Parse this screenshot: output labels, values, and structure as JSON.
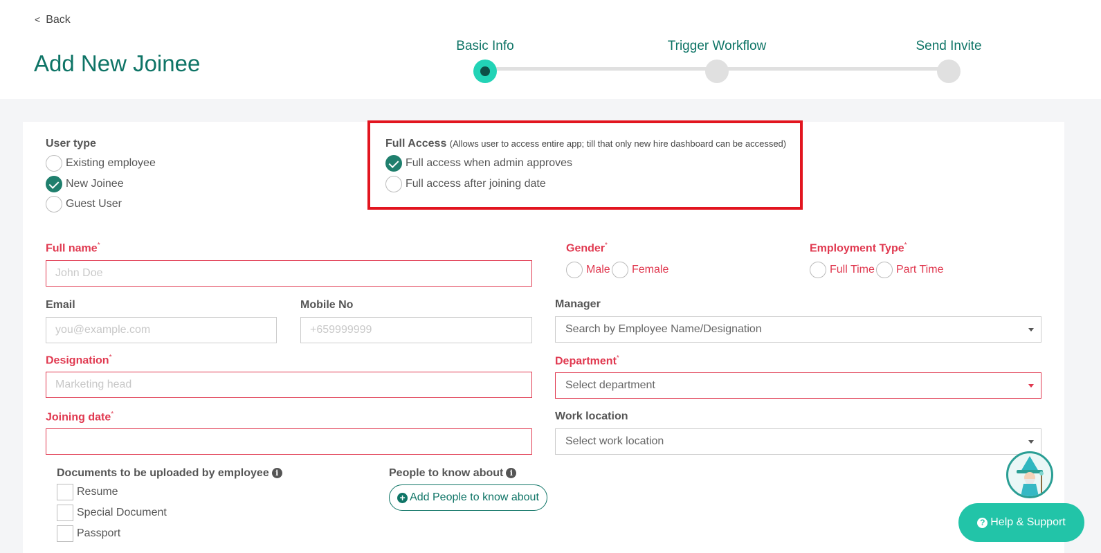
{
  "header": {
    "back_label": "Back",
    "page_title": "Add New Joinee"
  },
  "stepper": {
    "steps": [
      {
        "label": "Basic Info",
        "active": true
      },
      {
        "label": "Trigger Workflow",
        "active": false
      },
      {
        "label": "Send Invite",
        "active": false
      }
    ]
  },
  "user_type": {
    "label": "User type",
    "options": [
      {
        "label": "Existing employee",
        "checked": false
      },
      {
        "label": "New Joinee",
        "checked": true
      },
      {
        "label": "Guest User",
        "checked": false
      }
    ]
  },
  "full_access": {
    "label": "Full Access",
    "hint": "(Allows user to access entire app; till that only new hire dashboard can be accessed)",
    "options": [
      {
        "label": "Full access when admin approves",
        "checked": true
      },
      {
        "label": "Full access after joining date",
        "checked": false
      }
    ]
  },
  "form": {
    "full_name": {
      "label": "Full name",
      "required_mark": "*",
      "placeholder": "John Doe",
      "value": ""
    },
    "gender": {
      "label": "Gender",
      "required_mark": "*",
      "options": [
        "Male",
        "Female"
      ]
    },
    "employment_type": {
      "label": "Employment Type",
      "required_mark": "*",
      "options": [
        "Full Time",
        "Part Time"
      ]
    },
    "email": {
      "label": "Email",
      "placeholder": "you@example.com",
      "value": ""
    },
    "mobile": {
      "label": "Mobile No",
      "placeholder": "+659999999",
      "value": ""
    },
    "manager": {
      "label": "Manager",
      "placeholder": "Search by Employee Name/Designation"
    },
    "designation": {
      "label": "Designation",
      "required_mark": "*",
      "placeholder": "Marketing head",
      "value": ""
    },
    "department": {
      "label": "Department",
      "required_mark": "*",
      "placeholder": "Select department"
    },
    "joining_date": {
      "label": "Joining date",
      "required_mark": "*",
      "value": ""
    },
    "work_location": {
      "label": "Work location",
      "placeholder": "Select work location"
    }
  },
  "documents": {
    "label": "Documents to be uploaded by employee",
    "info_icon": "i",
    "items": [
      {
        "label": "Resume",
        "checked": false
      },
      {
        "label": "Special Document",
        "checked": false
      },
      {
        "label": "Passport",
        "checked": false
      }
    ]
  },
  "people": {
    "label": "People to know about",
    "info_icon": "i",
    "add_button": "Add People to know about"
  },
  "help": {
    "label": "Help & Support"
  },
  "colors": {
    "brand": "#0e7466",
    "accent": "#22d3b6",
    "required": "#e0384f",
    "highlight": "#e2151f"
  }
}
